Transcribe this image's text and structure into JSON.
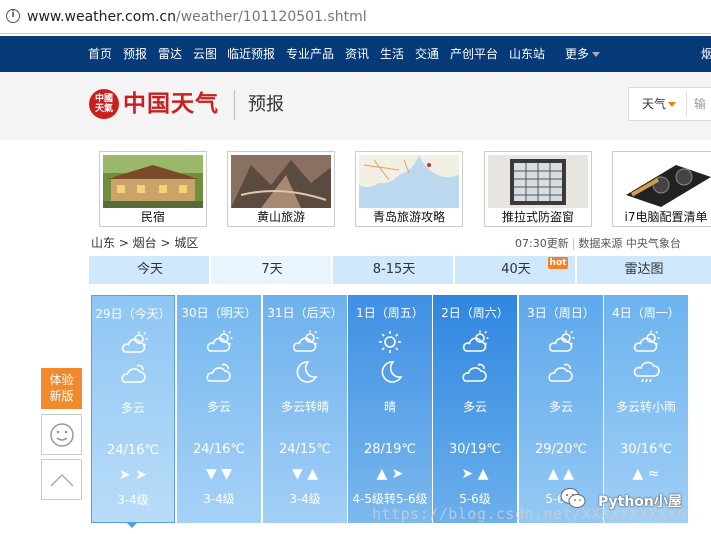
{
  "browser": {
    "url_host": "www.weather.com.cn",
    "url_path": "/weather/101120501.shtml"
  },
  "nav": {
    "items": [
      "首页",
      "预报",
      "雷达",
      "云图",
      "临近预报",
      "专业产品",
      "资讯",
      "生活",
      "交通",
      "产创平台",
      "山东站",
      "更多"
    ],
    "cut": "烟"
  },
  "logo": {
    "text": "中国天气",
    "seal": "中国天气",
    "section": "预报"
  },
  "search": {
    "type": "天气",
    "placeholder": "输"
  },
  "ads": [
    "民宿",
    "黄山旅游",
    "青岛旅游攻略",
    "推拉式防盗窗",
    "i7电脑配置清单"
  ],
  "breadcrumb": "山东 > 烟台 > 城区",
  "meta": {
    "updated": "07:30更新",
    "source": "数据来源 中央气象台"
  },
  "tabs": [
    "今天",
    "7天",
    "8-15天",
    "40天",
    "雷达图"
  ],
  "hot_badge": "hot",
  "days": [
    {
      "date": "29日（今天）",
      "icon1": "cloudy-sun-icon",
      "icon2": "cloudy-icon",
      "weather": "多云",
      "temp": "24/16℃",
      "wind": "➤ ➤",
      "level": "3-4级"
    },
    {
      "date": "30日（明天）",
      "icon1": "cloudy-sun-icon",
      "icon2": "cloudy-icon",
      "weather": "多云",
      "temp": "24/16℃",
      "wind": "▼ ▼",
      "level": "3-4级"
    },
    {
      "date": "31日（后天）",
      "icon1": "cloudy-sun-icon",
      "icon2": "moon-icon",
      "weather": "多云转晴",
      "temp": "24/15℃",
      "wind": "▼ ▲",
      "level": "3-4级"
    },
    {
      "date": "1日（周五）",
      "icon1": "sun-icon",
      "icon2": "moon-icon",
      "weather": "晴",
      "temp": "28/19℃",
      "wind": "▲ ➤",
      "level": "4-5级转5-6级"
    },
    {
      "date": "2日（周六）",
      "icon1": "cloudy-sun-icon",
      "icon2": "cloudy-icon",
      "weather": "多云",
      "temp": "30/19℃",
      "wind": "➤ ▲",
      "level": "5-6级"
    },
    {
      "date": "3日（周日）",
      "icon1": "cloudy-sun-icon",
      "icon2": "cloudy-icon",
      "weather": "多云",
      "temp": "29/20℃",
      "wind": "▲ ▲",
      "level": "5-6级"
    },
    {
      "date": "4日（周一）",
      "icon1": "cloudy-sun-icon",
      "icon2": "rain-icon",
      "weather": "多云转小雨",
      "temp": "30/16℃",
      "wind": "▲ ≈",
      "level": ""
    }
  ],
  "side": {
    "feedback": "体验新版"
  },
  "watermark": {
    "url": "https://blog.csdn.net/XXXXXXXXXXG",
    "account": "Python小屋"
  },
  "colors": {
    "nav": "#063a78",
    "brand_red": "#c9201e",
    "hot": "#f48120",
    "side": "#f08a2d"
  }
}
